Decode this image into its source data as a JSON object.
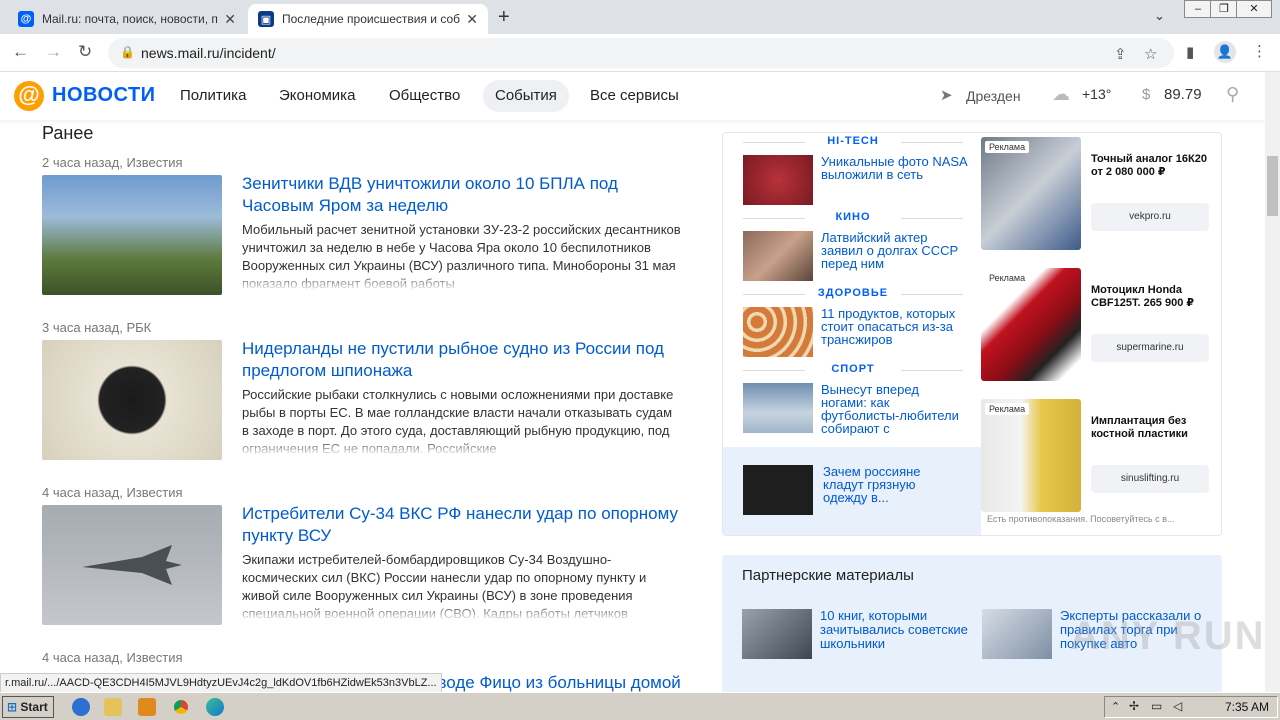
{
  "browser": {
    "tabs": [
      {
        "title": "Mail.ru: почта, поиск, новости, пр",
        "active": false
      },
      {
        "title": "Последние происшествия и событ",
        "active": true
      }
    ],
    "url": "news.mail.ru/incident/"
  },
  "site": {
    "logo_at": "@",
    "logo_text": "НОВОСТИ",
    "nav": [
      "Политика",
      "Экономика",
      "Общество",
      "События",
      "Все сервисы"
    ],
    "city": "Дрезден",
    "temperature": "+13°",
    "currency_symbol": "$",
    "rate": "89.79"
  },
  "feed": {
    "title": "Ранее",
    "articles": [
      {
        "meta": "2 часа назад, Известия",
        "headline": "Зенитчики ВДВ уничтожили около 10 БПЛА под Часовым Яром за неделю",
        "body": "Мобильный расчет зенитной установки ЗУ-23-2 российских десантников уничтожил за неделю в небе у Часова Яра около 10 беспилотников Вооруженных сил Украины (ВСУ) различного типа. Минобороны 31 мая показало фрагмент боевой работы"
      },
      {
        "meta": "3 часа назад, РБК",
        "headline": "Нидерланды не пустили рыбное судно из России под предлогом шпионажа",
        "body": "Российские рыбаки столкнулись с новыми осложнениями при доставке рыбы в порты ЕС. В мае голландские власти начали отказывать судам в заходе в порт. До этого суда, доставляющий рыбную продукцию, под ограничения ЕС не попадали. Российские"
      },
      {
        "meta": "4 часа назад, Известия",
        "headline": "Истребители Су-34 ВКС РФ нанесли удар по опорному пункту ВСУ",
        "body": "Экипажи истребителей-бомбардировщиков Су-34 Воздушно-космических сил (ВКС) России нанесли удар по опорному пункту и живой силе Вооруженных сил Украины (ВСУ) в зоне проведения специальной военной операции (СВО). Кадры работы летчиков"
      },
      {
        "meta": "4 часа назад, Известия",
        "headline": "еводе Фицо из больницы домой"
      }
    ]
  },
  "sidebar": {
    "sections": [
      {
        "category": "HI-TECH",
        "text": "Уникальные фото NASA выложили в сеть"
      },
      {
        "category": "КИНО",
        "text": "Латвийский актер заявил о долгах СССР перед ним"
      },
      {
        "category": "ЗДОРОВЬЕ",
        "text": "11 продуктов, которых стоит опасаться из-за трансжиров"
      },
      {
        "category": "СПОРТ",
        "text": "Вынесут вперед ногами: как футболисты-любители собирают с"
      }
    ],
    "promo": "Зачем россияне кладут грязную одежду в...",
    "ads": [
      {
        "label": "Реклама",
        "title": "Точный аналог 16К20 от 2 080 000 ₽",
        "domain": "vekpro.ru"
      },
      {
        "label": "Реклама",
        "title": "Мотоцикл Honda CBF125T. 265 900 ₽",
        "domain": "supermarine.ru"
      },
      {
        "label": "Реклама",
        "title": "Имплантация без костной пластики",
        "domain": "sinuslifting.ru"
      }
    ],
    "disclaimer": "Есть противопоказания. Посоветуйтесь с в..."
  },
  "partners": {
    "title": "Партнерские материалы",
    "items": [
      "10 книг, которыми зачитывались советские школьники",
      "Эксперты рассказали о правилах торга при покупке авто"
    ]
  },
  "status_url": "r.mail.ru/.../AACD-QE3CDH4I5MJVL9HdtyzUEvJ4c2g_ldKdOV1fb6HZidwEk53n3VbLZ...",
  "watermark": "ANY RUN",
  "taskbar": {
    "start": "Start",
    "clock": "7:35 AM"
  }
}
